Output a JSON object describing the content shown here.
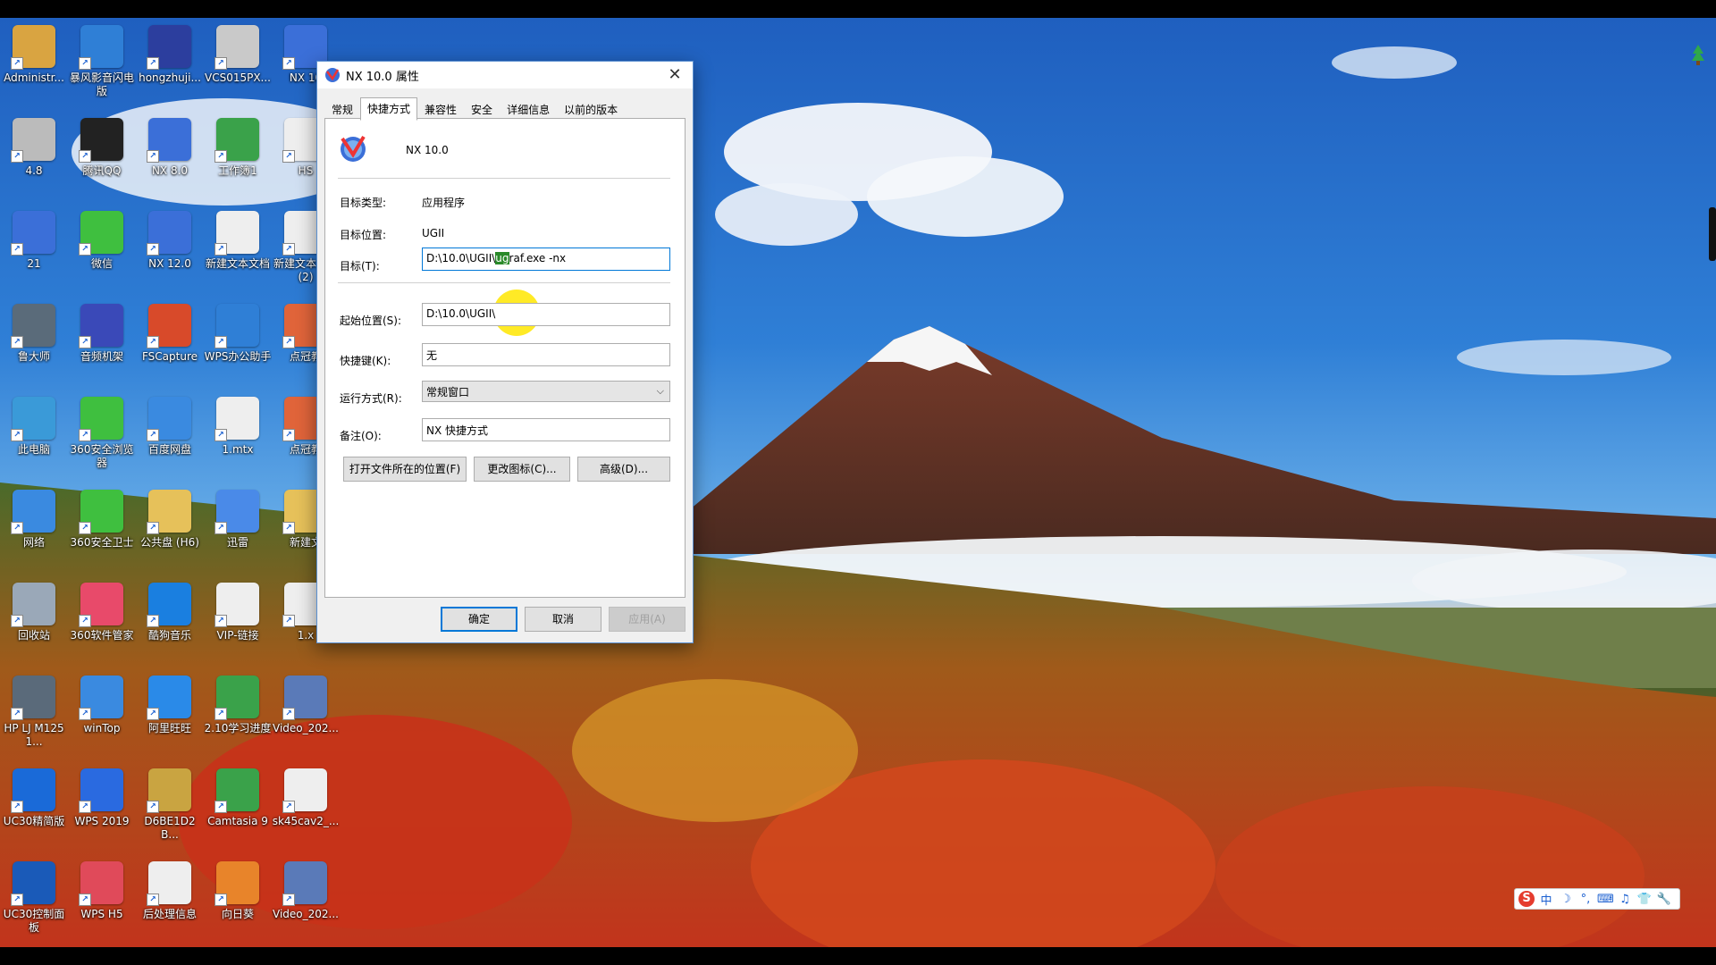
{
  "dialog": {
    "title": "NX 10.0 属性",
    "close_glyph": "✕",
    "tabs": [
      "常规",
      "快捷方式",
      "兼容性",
      "安全",
      "详细信息",
      "以前的版本"
    ],
    "active_tab": "快捷方式",
    "app_name": "NX 10.0",
    "fields": {
      "target_type_label": "目标类型:",
      "target_type_value": "应用程序",
      "target_location_label": "目标位置:",
      "target_location_value": "UGII",
      "target_label": "目标(T):",
      "target_value_prefix": "D:\\10.0\\UGII\\",
      "target_value_selected": "ug",
      "target_value_suffix": "raf.exe -nx",
      "start_in_label": "起始位置(S):",
      "start_in_value": "D:\\10.0\\UGII\\",
      "shortcut_key_label": "快捷键(K):",
      "shortcut_key_value": "无",
      "run_label": "运行方式(R):",
      "run_value": "常规窗口",
      "comment_label": "备注(O):",
      "comment_value": "NX 快捷方式"
    },
    "buttons": {
      "open_location": "打开文件所在的位置(F)",
      "change_icon": "更改图标(C)...",
      "advanced": "高级(D)...",
      "ok": "确定",
      "cancel": "取消",
      "apply": "应用(A)"
    }
  },
  "desktop_icons": [
    {
      "label": "Administr...",
      "icon": "user-folder-icon",
      "color": "#d9a441"
    },
    {
      "label": "暴风影音闪电版",
      "icon": "media-player-icon",
      "color": "#2f7fd6"
    },
    {
      "label": "hongzhuji...",
      "icon": "brush-icon",
      "color": "#2c3e9e"
    },
    {
      "label": "VCS015PX...",
      "icon": "file-icon",
      "color": "#c9c9c9"
    },
    {
      "label": "NX 10",
      "icon": "nx-icon",
      "color": "#3b6fd8"
    },
    {
      "label": "4.8",
      "icon": "monitor-icon",
      "color": "#bbbbbb"
    },
    {
      "label": "腾讯QQ",
      "icon": "qq-icon",
      "color": "#222222"
    },
    {
      "label": "NX 8.0",
      "icon": "nx-icon",
      "color": "#3b6fd8"
    },
    {
      "label": "工作簿1",
      "icon": "spreadsheet-icon",
      "color": "#3aa24a"
    },
    {
      "label": "HS",
      "icon": "file-icon",
      "color": "#eeeeee"
    },
    {
      "label": "21",
      "icon": "nx-icon",
      "color": "#3b6fd8"
    },
    {
      "label": "微信",
      "icon": "wechat-icon",
      "color": "#3fbf3f"
    },
    {
      "label": "NX 12.0",
      "icon": "nx-icon",
      "color": "#3b6fd8"
    },
    {
      "label": "新建文本文档",
      "icon": "text-file-icon",
      "color": "#eeeeee"
    },
    {
      "label": "新建文本文档 (2)",
      "icon": "text-file-icon",
      "color": "#eeeeee"
    },
    {
      "label": "鲁大师",
      "icon": "ludashi-icon",
      "color": "#5a6b7a"
    },
    {
      "label": "音频机架",
      "icon": "audio-icon",
      "color": "#3a49b8"
    },
    {
      "label": "FSCapture",
      "icon": "capture-icon",
      "color": "#d84a2a"
    },
    {
      "label": "WPS办公助手",
      "icon": "box-icon",
      "color": "#2f7fd6"
    },
    {
      "label": "点冠教",
      "icon": "ppt-icon",
      "color": "#e0643a"
    },
    {
      "label": "此电脑",
      "icon": "computer-icon",
      "color": "#3a9ad8"
    },
    {
      "label": "360安全浏览器",
      "icon": "browser-360-icon",
      "color": "#3fbf3f"
    },
    {
      "label": "百度网盘",
      "icon": "cloud-icon",
      "color": "#3a8ae0"
    },
    {
      "label": "1.mtx",
      "icon": "file-icon",
      "color": "#eeeeee"
    },
    {
      "label": "点冠教",
      "icon": "ppt-icon",
      "color": "#e0643a"
    },
    {
      "label": "网络",
      "icon": "network-icon",
      "color": "#3a8ae0"
    },
    {
      "label": "360安全卫士",
      "icon": "shield-360-icon",
      "color": "#3fbf3f"
    },
    {
      "label": "公共盘 (H6)",
      "icon": "folder-icon",
      "color": "#e6c15a"
    },
    {
      "label": "迅雷",
      "icon": "thunder-icon",
      "color": "#4a8ae8"
    },
    {
      "label": "新建文",
      "icon": "folder-icon",
      "color": "#e6c15a"
    },
    {
      "label": "回收站",
      "icon": "recycle-bin-icon",
      "color": "#9aa8b8"
    },
    {
      "label": "360软件管家",
      "icon": "apps-360-icon",
      "color": "#e84a6a"
    },
    {
      "label": "酷狗音乐",
      "icon": "kugou-icon",
      "color": "#1a7fe0"
    },
    {
      "label": "VIP-链接",
      "icon": "text-file-icon",
      "color": "#eeeeee"
    },
    {
      "label": "1.x",
      "icon": "file-icon",
      "color": "#eeeeee"
    },
    {
      "label": "HP LJ M1251...",
      "icon": "printer-icon",
      "color": "#5a6a7a"
    },
    {
      "label": "winTop",
      "icon": "window-icon",
      "color": "#3a8ae0"
    },
    {
      "label": "阿里旺旺",
      "icon": "wangwang-icon",
      "color": "#2a8ae8"
    },
    {
      "label": "2.10学习进度",
      "icon": "spreadsheet-icon",
      "color": "#3aa24a"
    },
    {
      "label": "Video_202...",
      "icon": "video-icon",
      "color": "#5a7ab8"
    },
    {
      "label": "UC30精简版",
      "icon": "uc-icon",
      "color": "#1a6ad8"
    },
    {
      "label": "WPS 2019",
      "icon": "wps-icon",
      "color": "#2a6ae0"
    },
    {
      "label": "D6BE1D2B...",
      "icon": "phone-icon",
      "color": "#c9a441"
    },
    {
      "label": "Camtasia 9",
      "icon": "camtasia-icon",
      "color": "#3aa24a"
    },
    {
      "label": "sk45cav2_...",
      "icon": "file-icon",
      "color": "#eeeeee"
    },
    {
      "label": "UC30控制面板",
      "icon": "bb-icon",
      "color": "#1a5ab8"
    },
    {
      "label": "WPS H5",
      "icon": "wps-h5-icon",
      "color": "#e04a5a"
    },
    {
      "label": "后处理信息",
      "icon": "text-file-icon",
      "color": "#eeeeee"
    },
    {
      "label": "向日葵",
      "icon": "sunflower-icon",
      "color": "#e8842a"
    },
    {
      "label": "Video_202...",
      "icon": "video-icon",
      "color": "#5a7ab8"
    }
  ],
  "ime_bar": {
    "logo": "S",
    "items": [
      "中",
      "☽",
      "°,",
      "⌨",
      "♫",
      "👕",
      "🔧"
    ]
  }
}
